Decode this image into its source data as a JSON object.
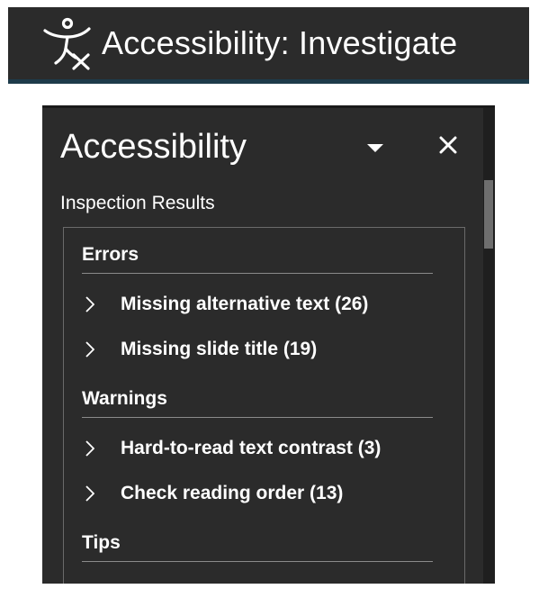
{
  "ribbon": {
    "label": "Accessibility: Investigate",
    "icon": "accessibility-person-icon"
  },
  "pane": {
    "title": "Accessibility",
    "dropdown_icon": "triangle-down-icon",
    "close_icon": "close-icon",
    "inspection_label": "Inspection Results",
    "sections": {
      "errors": {
        "label": "Errors",
        "items": [
          {
            "label": "Missing alternative text (26)"
          },
          {
            "label": "Missing slide title (19)"
          }
        ]
      },
      "warnings": {
        "label": "Warnings",
        "items": [
          {
            "label": "Hard-to-read text contrast (3)"
          },
          {
            "label": "Check reading order (13)"
          }
        ]
      },
      "tips": {
        "label": "Tips",
        "items": []
      }
    }
  },
  "colors": {
    "pane_background": "#2b2b2b",
    "text": "#ffffff",
    "ribbon_accent": "#1d3b4a"
  }
}
